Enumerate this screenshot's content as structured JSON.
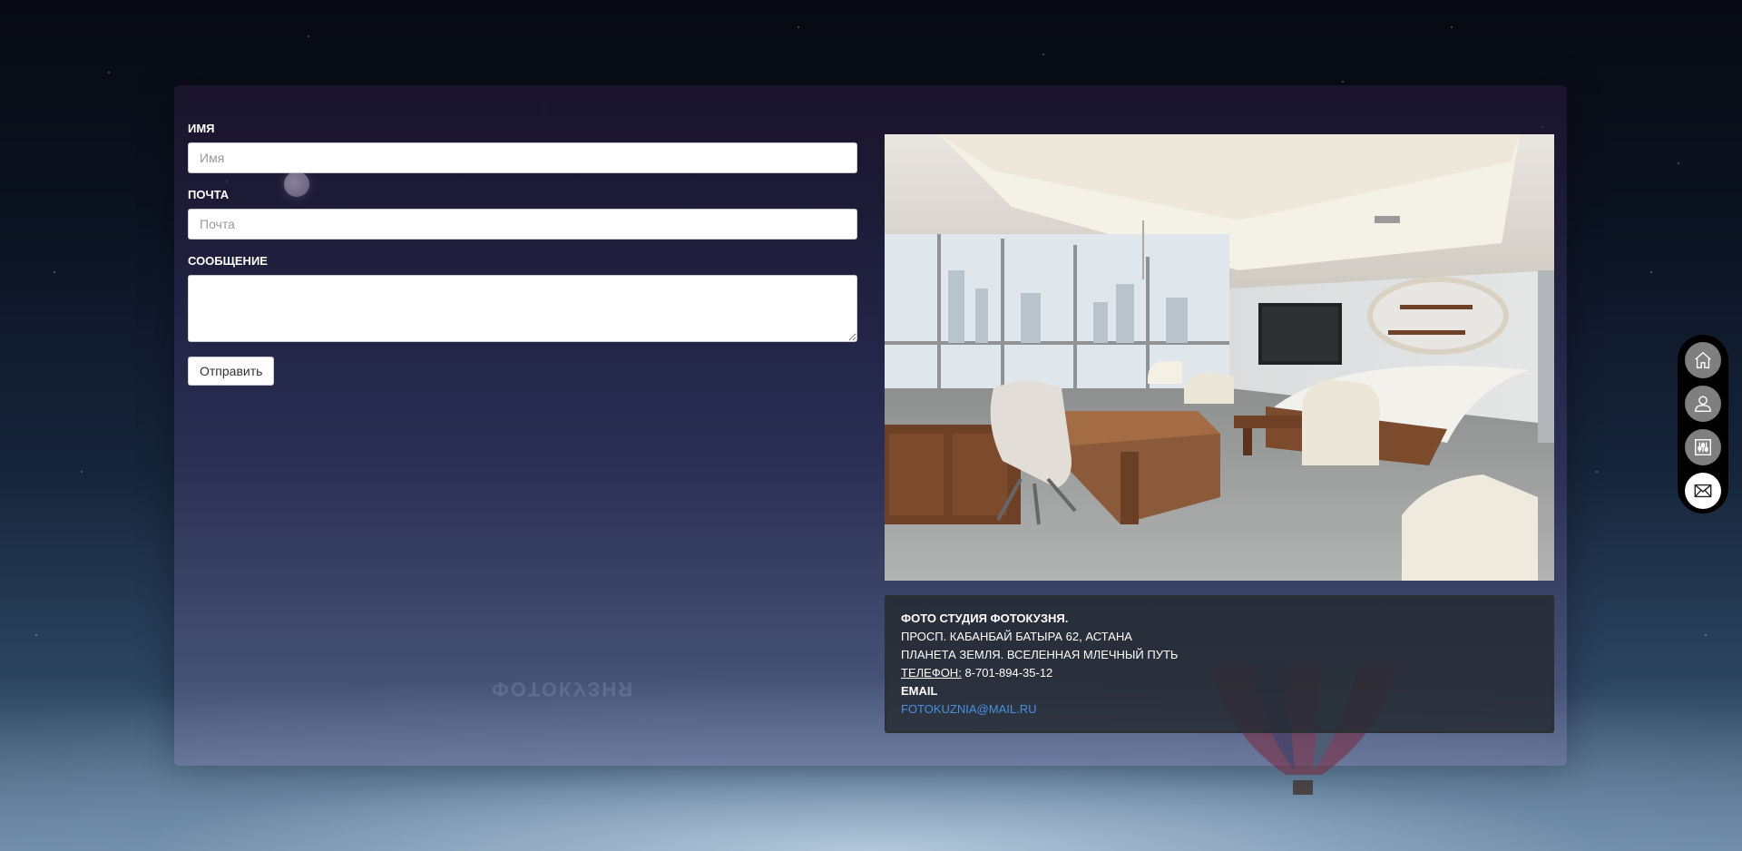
{
  "form": {
    "name_label": "Имя",
    "name_placeholder": "Имя",
    "email_label": "Почта",
    "email_placeholder": "Почта",
    "message_label": "Сообщение",
    "submit_label": "Отправить"
  },
  "contact": {
    "studio": "Фото студия ФотоКузня.",
    "address": "Просп. Кабанбай Батыра 62, Астана",
    "planet": "Планета Земля. Вселенная Млечный Путь",
    "phone_label": "Телефон:",
    "phone": "8-701-894-35-12",
    "email_label": "Email",
    "email": "fotokuznia@mail.ru"
  },
  "background": {
    "watermark": "ФОТОКУЗНЯ"
  },
  "sidenav": {
    "items": [
      {
        "icon": "home-icon",
        "active": false
      },
      {
        "icon": "user-icon",
        "active": false
      },
      {
        "icon": "sliders-icon",
        "active": false
      },
      {
        "icon": "mail-icon",
        "active": true
      }
    ]
  },
  "colors": {
    "link": "#4a90e2",
    "info_box_bg": "#232a30",
    "nav_active": "#ffffff",
    "nav_inactive": "#7f7f7f"
  }
}
